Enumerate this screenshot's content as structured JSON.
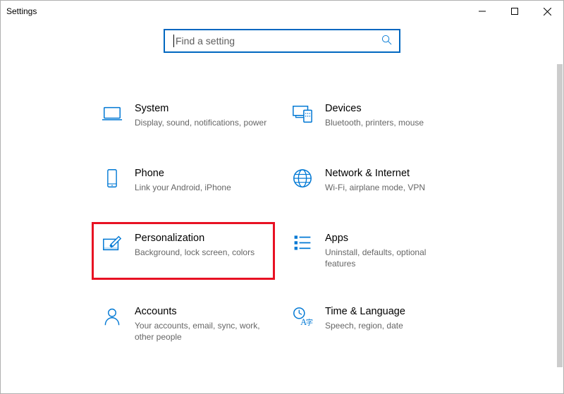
{
  "window": {
    "title": "Settings"
  },
  "search": {
    "placeholder": "Find a setting"
  },
  "tiles": [
    {
      "id": "system",
      "title": "System",
      "desc": "Display, sound, notifications, power"
    },
    {
      "id": "devices",
      "title": "Devices",
      "desc": "Bluetooth, printers, mouse"
    },
    {
      "id": "phone",
      "title": "Phone",
      "desc": "Link your Android, iPhone"
    },
    {
      "id": "network",
      "title": "Network & Internet",
      "desc": "Wi-Fi, airplane mode, VPN"
    },
    {
      "id": "personalization",
      "title": "Personalization",
      "desc": "Background, lock screen, colors"
    },
    {
      "id": "apps",
      "title": "Apps",
      "desc": "Uninstall, defaults, optional features"
    },
    {
      "id": "accounts",
      "title": "Accounts",
      "desc": "Your accounts, email, sync, work, other people"
    },
    {
      "id": "time",
      "title": "Time & Language",
      "desc": "Speech, region, date"
    }
  ],
  "highlighted": "personalization",
  "colors": {
    "accent": "#0078d4",
    "highlight": "#e81123"
  }
}
